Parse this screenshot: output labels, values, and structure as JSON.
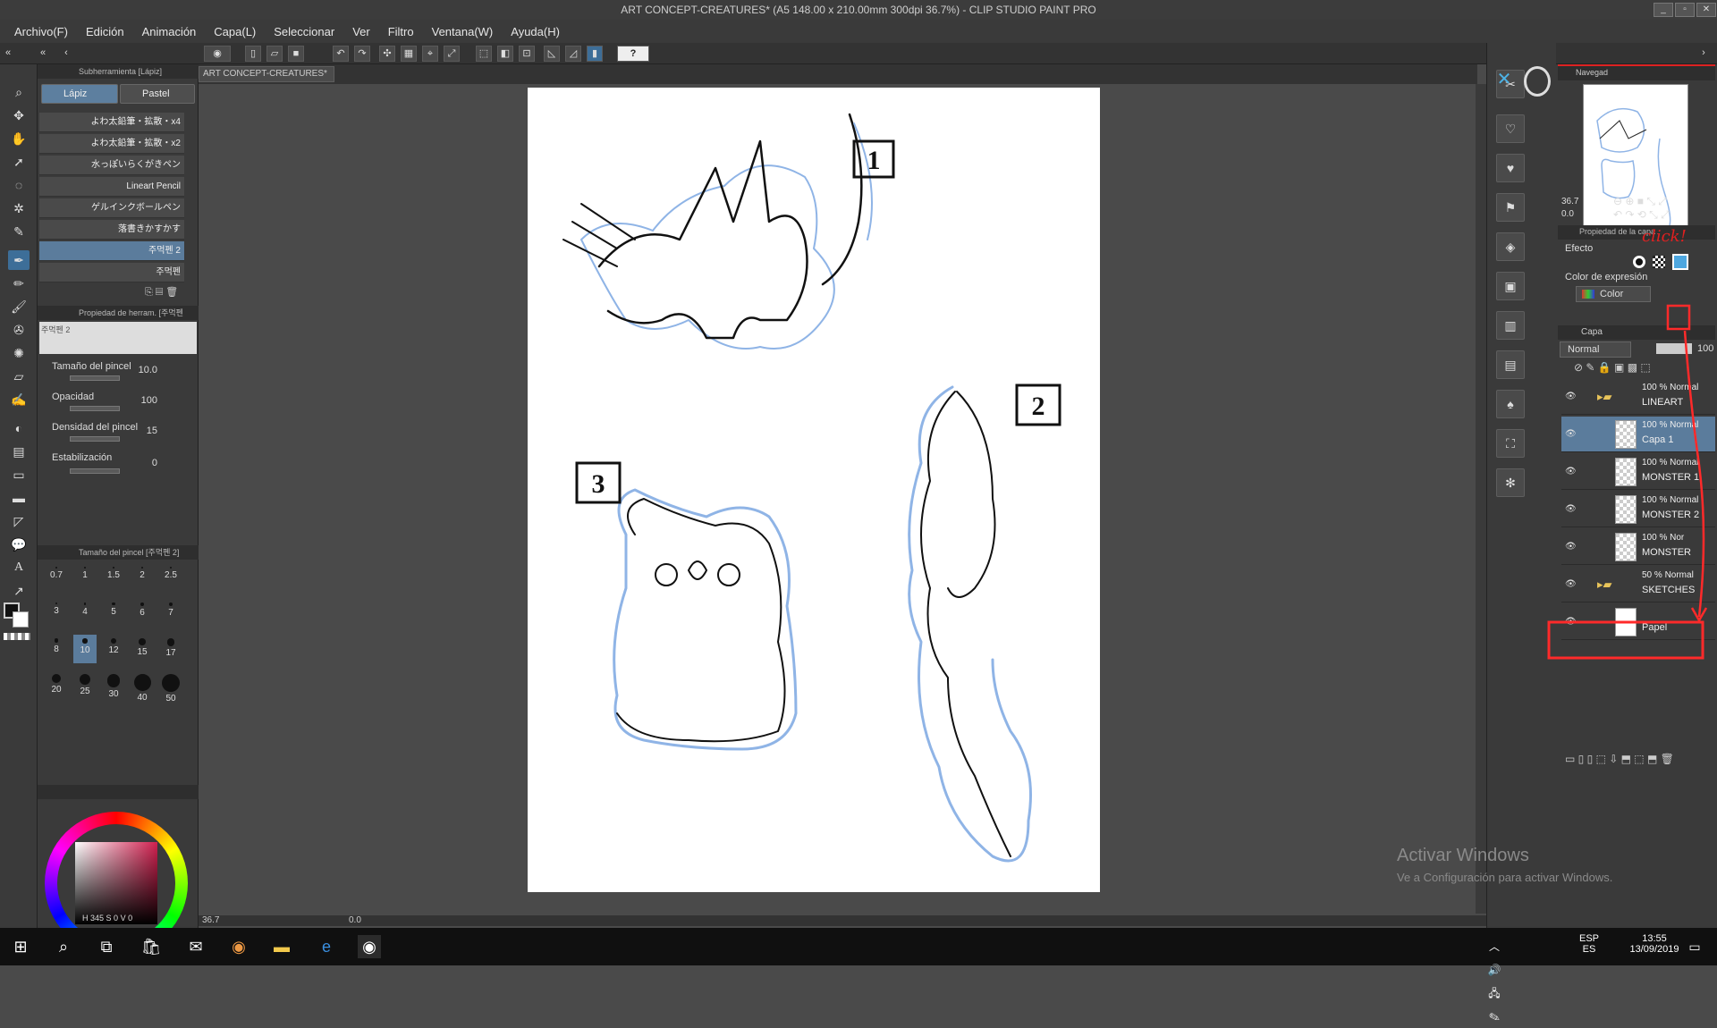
{
  "title": "ART CONCEPT-CREATURES* (A5 148.00 x 210.00mm 300dpi 36.7%) - CLIP STUDIO PAINT PRO",
  "menu": [
    "Archivo(F)",
    "Edición",
    "Animación",
    "Capa(L)",
    "Seleccionar",
    "Ver",
    "Filtro",
    "Ventana(W)",
    "Ayuda(H)"
  ],
  "doc_tab": "ART CONCEPT-CREATURES*",
  "subtool_panel": {
    "title": "Subherramienta [Lápiz]",
    "tabs": [
      "Lápiz",
      "Pastel"
    ],
    "brushes": [
      "よわ太鉛筆・拡散・x4",
      "よわ太鉛筆・拡散・x2",
      "水っぽいらくがきペン",
      "Lineart Pencil",
      "ゲルインクボールペン",
      "落書きかすかす",
      "주먹펜 2",
      "주먹펜"
    ],
    "selected_brush": "주먹펜 2"
  },
  "tool_property": {
    "title": "Propiedad de herram. [주먹펜",
    "preview_label": "주먹펜 2",
    "rows": [
      {
        "label": "Tamaño del pincel",
        "value": "10.0"
      },
      {
        "label": "Opacidad",
        "value": "100"
      },
      {
        "label": "Densidad del pincel",
        "value": "15"
      },
      {
        "label": "Estabilización",
        "value": "0"
      }
    ]
  },
  "brush_size": {
    "title": "Tamaño del pincel [주먹펜 2]",
    "sizes": [
      "0.7",
      "1",
      "1.5",
      "2",
      "2.5",
      "3",
      "4",
      "5",
      "6",
      "7",
      "8",
      "10",
      "12",
      "15",
      "17",
      "20",
      "25",
      "30",
      "40",
      "50"
    ],
    "selected": "10"
  },
  "color_readout": {
    "h": "345",
    "s": "0",
    "v": "0"
  },
  "zoom": "36.7",
  "statusbar": {
    "angle": "0.0"
  },
  "navigator": {
    "title": "Navegad",
    "zoom": "36.7",
    "rotate": "0.0"
  },
  "layer_property": {
    "title": "Propiedad de la capa",
    "effect_label": "Efecto",
    "expr_label": "Color de expresión",
    "expr_value": "Color",
    "annotation": "click!"
  },
  "layers_panel": {
    "tab": "Capa",
    "blend": "Normal",
    "opacity": "100",
    "layers": [
      {
        "mode": "100 % Normal",
        "name": "LINEART",
        "type": "folder"
      },
      {
        "mode": "100 % Normal",
        "name": "Capa 1",
        "type": "layer",
        "selected": true
      },
      {
        "mode": "100 % Normal",
        "name": "MONSTER 1",
        "type": "layer"
      },
      {
        "mode": "100 % Normal",
        "name": "MONSTER 2",
        "type": "layer"
      },
      {
        "mode": "100 % Nor",
        "name": "MONSTER",
        "type": "layer"
      },
      {
        "mode": "50 % Normal",
        "name": "SKETCHES",
        "type": "folder",
        "highlight": true
      },
      {
        "mode": "",
        "name": "Papel",
        "type": "paper"
      }
    ]
  },
  "watermark": {
    "line1": "Activar Windows",
    "line2": "Ve a Configuración para activar Windows."
  },
  "canvas_labels": [
    "1",
    "2",
    "3"
  ],
  "taskbar": {
    "lang": "ESP",
    "lang2": "ES",
    "time": "13:55",
    "date": "13/09/2019"
  }
}
